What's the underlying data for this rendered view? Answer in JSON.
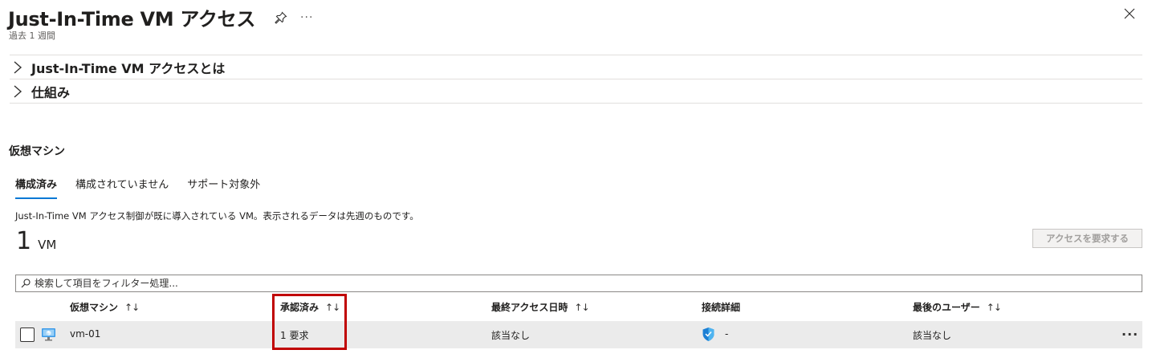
{
  "header": {
    "title": "Just-In-Time VM アクセス",
    "subtitle": "過去 1 週間",
    "more_label": "···"
  },
  "expanders": [
    {
      "label": "Just-In-Time VM アクセスとは"
    },
    {
      "label": "仕組み"
    }
  ],
  "section": {
    "title": "仮想マシン"
  },
  "tabs": [
    {
      "label": "構成済み",
      "active": true
    },
    {
      "label": "構成されていません",
      "active": false
    },
    {
      "label": "サポート対象外",
      "active": false
    }
  ],
  "description": "Just-In-Time VM アクセス制御が既に導入されている VM。表示されるデータは先週のものです。",
  "summary": {
    "count": "1",
    "unit": "VM"
  },
  "request_button": {
    "label": "アクセスを要求する",
    "disabled": true
  },
  "filter": {
    "placeholder": "検索して項目をフィルター処理...",
    "value": ""
  },
  "table": {
    "columns": [
      {
        "label": "仮想マシン",
        "sortable": true
      },
      {
        "label": "承認済み",
        "sortable": true
      },
      {
        "label": "最終アクセス日時",
        "sortable": true
      },
      {
        "label": "接続詳細",
        "sortable": false
      },
      {
        "label": "最後のユーザー",
        "sortable": true
      }
    ],
    "sort_glyph": "↑↓",
    "rows": [
      {
        "vm": "vm-01",
        "approved": "1 要求",
        "last_access": "該当なし",
        "connection": "-",
        "last_user": "該当なし",
        "more": "···"
      }
    ]
  },
  "icons": {
    "pin": "pin-icon",
    "close": "close-icon",
    "chevron": "chevron-right-icon",
    "search": "search-icon",
    "vm": "virtual-machine-icon",
    "shield": "shield-icon"
  },
  "colors": {
    "accent": "#0078d4",
    "highlight": "#c00000",
    "row_background": "#ebebeb"
  }
}
